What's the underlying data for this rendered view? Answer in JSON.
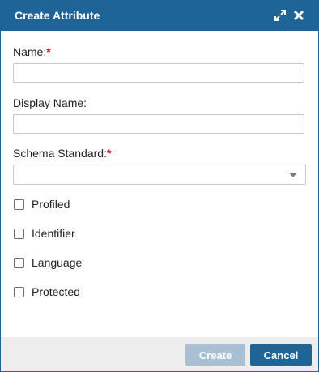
{
  "dialog": {
    "title": "Create Attribute",
    "icons": {
      "expand": "expand-icon",
      "close": "close-icon"
    }
  },
  "form": {
    "name": {
      "label": "Name:",
      "required_mark": "*",
      "value": ""
    },
    "display_name": {
      "label": "Display Name:",
      "value": ""
    },
    "schema_standard": {
      "label": "Schema Standard:",
      "required_mark": "*",
      "selected": ""
    },
    "checkboxes": [
      {
        "label": "Profiled",
        "checked": false
      },
      {
        "label": "Identifier",
        "checked": false
      },
      {
        "label": "Language",
        "checked": false
      },
      {
        "label": "Protected",
        "checked": false
      }
    ]
  },
  "footer": {
    "create_label": "Create",
    "cancel_label": "Cancel"
  },
  "colors": {
    "primary": "#1f6497",
    "primary_disabled": "#a9c0d4",
    "required": "#d71920",
    "footer_bg": "#ededed"
  }
}
